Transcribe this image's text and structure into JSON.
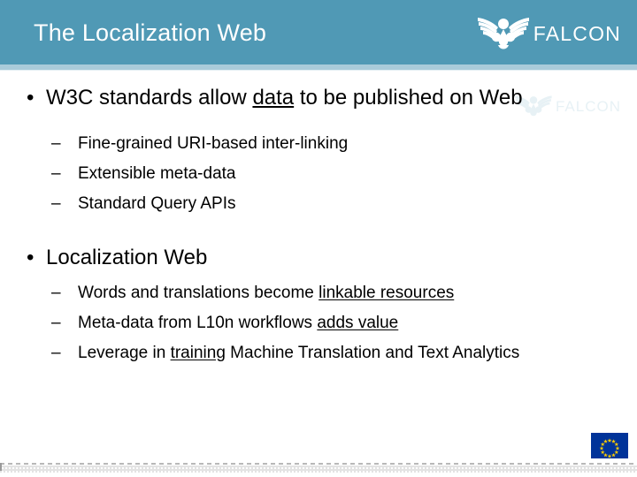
{
  "header": {
    "title": "The Localization Web",
    "background_color": "#5099b5",
    "underline_color": "#a9cbda",
    "title_color": "#ffffff",
    "logo": {
      "name": "falcon-logo",
      "wordmark": "FALCON",
      "icon": "falcon-bird-icon"
    }
  },
  "watermark": {
    "wordmark": "FALCON",
    "icon": "falcon-bird-icon"
  },
  "content": {
    "groups": [
      {
        "bullet": {
          "marker": "•",
          "segments": [
            {
              "text": "W3C standards allow ",
              "underline": false
            },
            {
              "text": "data",
              "underline": true
            },
            {
              "text": " to be published on Web",
              "underline": false
            }
          ]
        },
        "sub_bullets": [
          {
            "marker": "–",
            "segments": [
              {
                "text": "Fine-grained URI-based inter-linking",
                "underline": false
              }
            ]
          },
          {
            "marker": "–",
            "segments": [
              {
                "text": "Extensible meta-data",
                "underline": false
              }
            ]
          },
          {
            "marker": "–",
            "segments": [
              {
                "text": "Standard Query APIs",
                "underline": false
              }
            ]
          }
        ]
      },
      {
        "bullet": {
          "marker": "•",
          "segments": [
            {
              "text": "Localization Web",
              "underline": false
            }
          ]
        },
        "sub_bullets": [
          {
            "marker": "–",
            "segments": [
              {
                "text": "Words and translations become ",
                "underline": false
              },
              {
                "text": "linkable resources",
                "underline": true
              }
            ]
          },
          {
            "marker": "–",
            "segments": [
              {
                "text": "Meta-data from L10n workflows ",
                "underline": false
              },
              {
                "text": "adds value",
                "underline": true
              }
            ]
          },
          {
            "marker": "–",
            "segments": [
              {
                "text": "Leverage in ",
                "underline": false
              },
              {
                "text": "training",
                "underline": true
              },
              {
                "text": " Machine Translation and Text Analytics",
                "underline": false
              }
            ]
          }
        ]
      }
    ]
  },
  "footer": {
    "eu_flag": {
      "name": "eu-flag",
      "field_color": "#003399",
      "star_color": "#ffcc00",
      "star_count": 12
    }
  }
}
